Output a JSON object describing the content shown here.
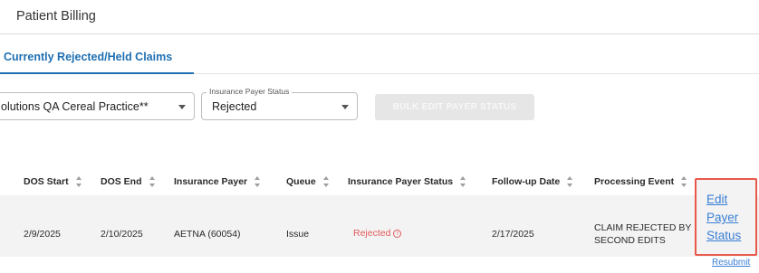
{
  "header": {
    "title": "Patient Billing"
  },
  "tabs": [
    {
      "label": "Currently Rejected/Held Claims",
      "active": true
    }
  ],
  "filters": {
    "practice": {
      "value": "olutions QA Cereal Practice**"
    },
    "payer_status": {
      "label": "Insurance Payer Status",
      "value": "Rejected"
    },
    "bulk_button": {
      "label": "BULK EDIT PAYER STATUS",
      "disabled": true
    }
  },
  "table": {
    "columns": [
      "DOS Start",
      "DOS End",
      "Insurance Payer",
      "Queue",
      "Insurance Payer Status",
      "Follow-up Date",
      "Processing Event"
    ],
    "rows": [
      {
        "dos_start": "2/9/2025",
        "dos_end": "2/10/2025",
        "insurance_payer": "AETNA (60054)",
        "queue": "Issue",
        "payer_status": "Rejected",
        "follow_up_date": "2/17/2025",
        "processing_event": "CLAIM REJECTED BY SECOND EDITS",
        "edit_link": "Edit Payer Status",
        "resubmit_link": "Resubmit"
      }
    ]
  },
  "colors": {
    "accent": "#1f6fb2",
    "link": "#3a7fd5",
    "rejected": "#e35a5a",
    "highlight_border": "#e8594c"
  },
  "icons": {
    "sort": "sort-arrows-icon",
    "info": "info-circle-icon",
    "dropdown": "chevron-down-icon"
  }
}
